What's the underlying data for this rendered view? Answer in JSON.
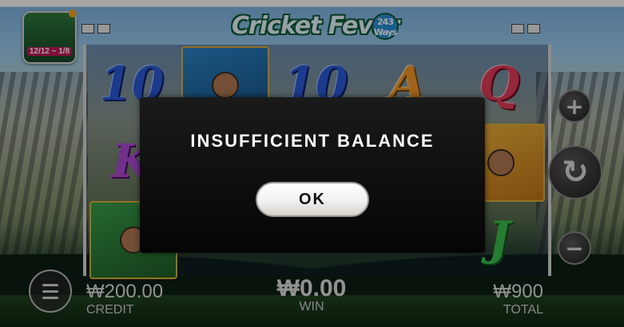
{
  "game": {
    "logo_text": "Cricket Fever",
    "ways_badge": "243 Ways",
    "promo_date": "12/12 ~ 1/8"
  },
  "reels": [
    {
      "symbols": [
        {
          "label": "10",
          "style": "blue"
        },
        {
          "label": "K",
          "style": "purple"
        },
        {
          "label": "",
          "style": "player green"
        }
      ]
    },
    {
      "symbols": [
        {
          "label": "",
          "style": "player"
        },
        {
          "label": "",
          "style": "blank"
        },
        {
          "label": "",
          "style": "blank"
        }
      ]
    },
    {
      "symbols": [
        {
          "label": "10",
          "style": "blue"
        },
        {
          "label": "",
          "style": "blank"
        },
        {
          "label": "",
          "style": "blank"
        }
      ]
    },
    {
      "symbols": [
        {
          "label": "A",
          "style": "orange"
        },
        {
          "label": "",
          "style": "blank"
        },
        {
          "label": "",
          "style": "blank"
        }
      ]
    },
    {
      "symbols": [
        {
          "label": "Q",
          "style": "red"
        },
        {
          "label": "",
          "style": "player gold"
        },
        {
          "label": "J",
          "style": "green"
        }
      ]
    }
  ],
  "controls": {
    "plus_icon": "+",
    "spin_icon": "↻",
    "minus_icon": "−",
    "menu_icon": "menu-icon"
  },
  "meters": {
    "credit": {
      "value": "₩200.00",
      "label": "CREDIT"
    },
    "win": {
      "value": "₩0.00",
      "label": "WIN"
    },
    "total": {
      "value": "₩900",
      "label": "TOTAL"
    }
  },
  "dialog": {
    "message": "INSUFFICIENT BALANCE",
    "ok_label": "OK"
  },
  "colors": {
    "dialog_bg": "#0a0a0a",
    "ok_button_bg": "#f4f4f4",
    "promo_badge": "#c4185a",
    "notification_dot": "#f5a623"
  }
}
